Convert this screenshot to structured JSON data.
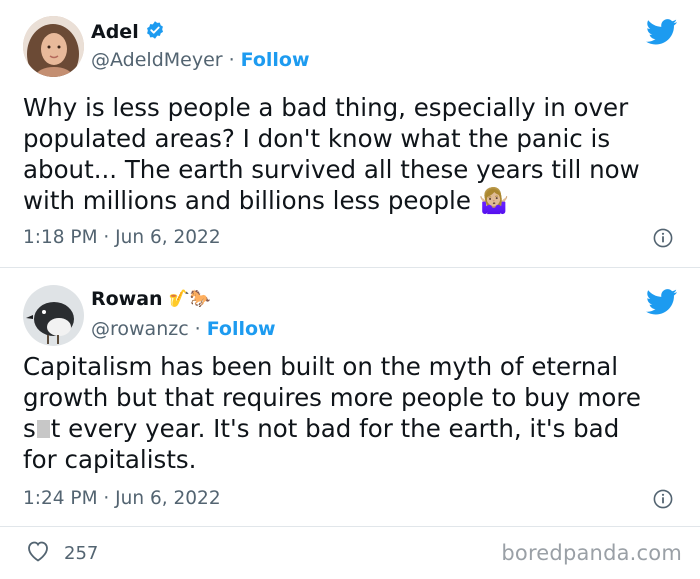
{
  "tweets": [
    {
      "name": "Adel",
      "name_badge_icon": "verified-badge-icon",
      "handle": "@AdeldMeyer",
      "separator": "·",
      "follow_label": "Follow",
      "body_lines": [
        "Why is less people a bad thing, especially in over",
        "populated areas? I don't know what the panic is",
        "about... The earth survived all these years till now",
        "with millions and billions less people"
      ],
      "body_emoji": "🤷🏼‍♀️",
      "time": "1:18 PM · Jun 6, 2022"
    },
    {
      "name": "Rowan",
      "name_emojis": "🎷🐎",
      "handle": "@rowanzc",
      "separator": "·",
      "follow_label": "Follow",
      "body_lines": [
        "Capitalism has been built on the myth of eternal",
        "growth but that requires more people to buy more",
        "t every year. It's not bad for the earth, it's bad",
        "for capitalists."
      ],
      "body_line3_prefix": "s",
      "time": "1:24 PM · Jun 6, 2022"
    }
  ],
  "footer": {
    "like_count": "257",
    "brand": "boredpanda.com"
  },
  "colors": {
    "twitter_blue": "#1d9bf0",
    "text": "#0f1419",
    "muted": "#536471"
  }
}
